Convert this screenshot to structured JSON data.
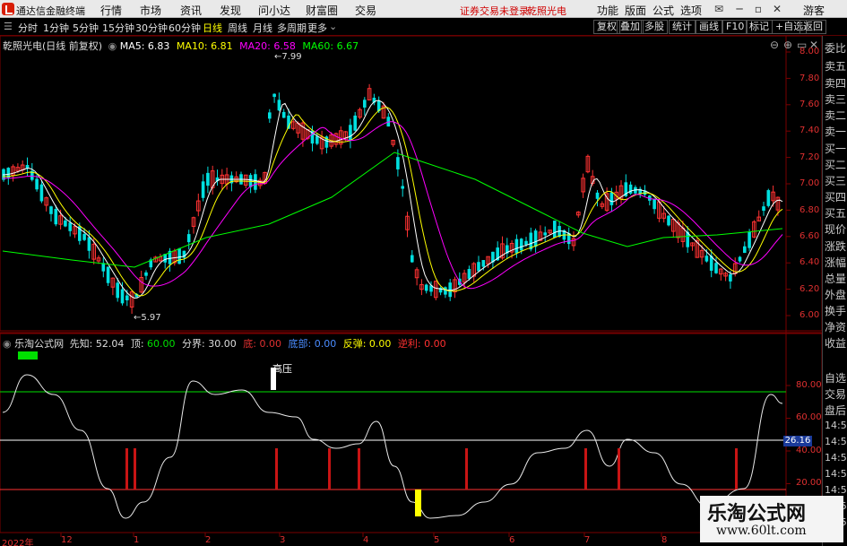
{
  "menubar": {
    "app_title": "通达信金融终端",
    "menus": [
      "行情",
      "市场",
      "资讯",
      "发现",
      "问小达",
      "财富圈",
      "交易"
    ],
    "notice": "证券交易未登录",
    "stock": "乾照光电",
    "right_menus": [
      "功能",
      "版面",
      "公式",
      "选项"
    ],
    "guest": "游客"
  },
  "toolbar": {
    "periods": [
      "分时",
      "1分钟",
      "5分钟",
      "15分钟",
      "30分钟",
      "60分钟",
      "日线",
      "周线",
      "月线",
      "多周期",
      "更多"
    ],
    "active_period": "日线",
    "right_buttons": [
      "复权",
      "叠加",
      "多股",
      "统计",
      "画线",
      "F10",
      "标记",
      "+自选",
      "返回"
    ]
  },
  "ma_line": {
    "title": "乾照光电(日线 前复权)",
    "ma5_label": "MA5: 6.83",
    "ma10_label": "MA10: 6.81",
    "ma20_label": "MA20: 6.58",
    "ma60_label": "MA60: 6.67",
    "colors": {
      "ma5": "#ffffff",
      "ma10": "#ffff00",
      "ma20": "#ff00ff",
      "ma60": "#00ff00"
    }
  },
  "main_chart": {
    "high_label": "7.99",
    "low_label": "5.97",
    "y_ticks": [
      "8.00",
      "7.80",
      "7.60",
      "7.40",
      "7.20",
      "7.00",
      "6.80",
      "6.60",
      "6.40",
      "6.20",
      "6.00"
    ]
  },
  "indicator": {
    "name": "乐淘公式网",
    "prophet_label": "先知:",
    "prophet_value": "52.04",
    "top_label": "顶:",
    "top_value": "60.00",
    "bound_label": "分界:",
    "bound_value": "30.00",
    "base_label": "底:",
    "base_value": "0.00",
    "bottom_label": "底部:",
    "bottom_value": "0.00",
    "rebound_label": "反弹:",
    "rebound_value": "0.00",
    "profit_label": "逆利:",
    "profit_value": "0.00",
    "pressure_label": "高压",
    "y_ticks": [
      "80.00",
      "60.00",
      "40.00",
      "20.00"
    ],
    "current_value": "26.16"
  },
  "x_axis": {
    "labels": [
      "2022年",
      "12",
      "1",
      "2",
      "3",
      "4",
      "5",
      "6",
      "7",
      "8"
    ]
  },
  "right_panel": {
    "items": [
      "委比",
      "卖五",
      "卖四",
      "卖三",
      "卖二",
      "卖一",
      "买一",
      "买二",
      "买三",
      "买四",
      "买五",
      "现价",
      "涨跌",
      "涨幅",
      "总量",
      "外盘",
      "换手",
      "净资",
      "收益",
      "",
      "自选",
      "交易",
      "盘后"
    ],
    "times": [
      "14:56",
      "14:56",
      "14:56",
      "14:56",
      "14:56",
      "14:56",
      "14:56"
    ]
  },
  "watermark": {
    "title": "乐淘公式网",
    "url": "www.60lt.com"
  }
}
